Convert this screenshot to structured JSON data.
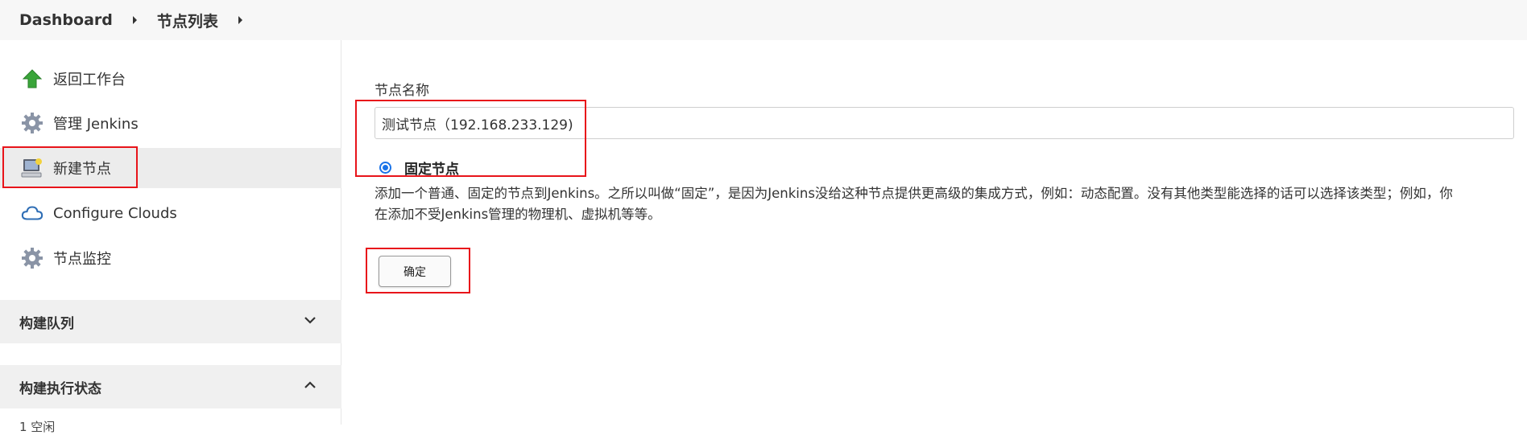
{
  "breadcrumb": {
    "items": [
      "Dashboard",
      "节点列表"
    ]
  },
  "sidebar": {
    "items": [
      {
        "label": "返回工作台",
        "icon": "up-arrow-icon"
      },
      {
        "label": "管理 Jenkins",
        "icon": "gear-icon"
      },
      {
        "label": "新建节点",
        "icon": "computer-icon"
      },
      {
        "label": "Configure Clouds",
        "icon": "cloud-icon"
      },
      {
        "label": "节点监控",
        "icon": "gear-icon"
      }
    ],
    "sections": [
      {
        "label": "构建队列",
        "state": "collapsed"
      },
      {
        "label": "构建执行状态",
        "state": "expanded"
      }
    ],
    "executor_item": "1 空闲"
  },
  "form": {
    "name_label": "节点名称",
    "name_value": "测试节点（192.168.233.129)",
    "radio_label": "固定节点",
    "description_line1": "添加一个普通、固定的节点到Jenkins。之所以叫做“固定”，是因为Jenkins没给这种节点提供更高级的集成方式，例如：动态配置。没有其他类型能选择的话可以选择该类型；例如，你",
    "description_line2": "在添加不受Jenkins管理的物理机、虚拟机等等。",
    "ok_label": "确定"
  },
  "colors": {
    "highlight": "#e8141a",
    "radio_accent": "#1a73e8",
    "breadcrumb_bg": "#f7f7f7",
    "active_item_bg": "#ececec"
  }
}
